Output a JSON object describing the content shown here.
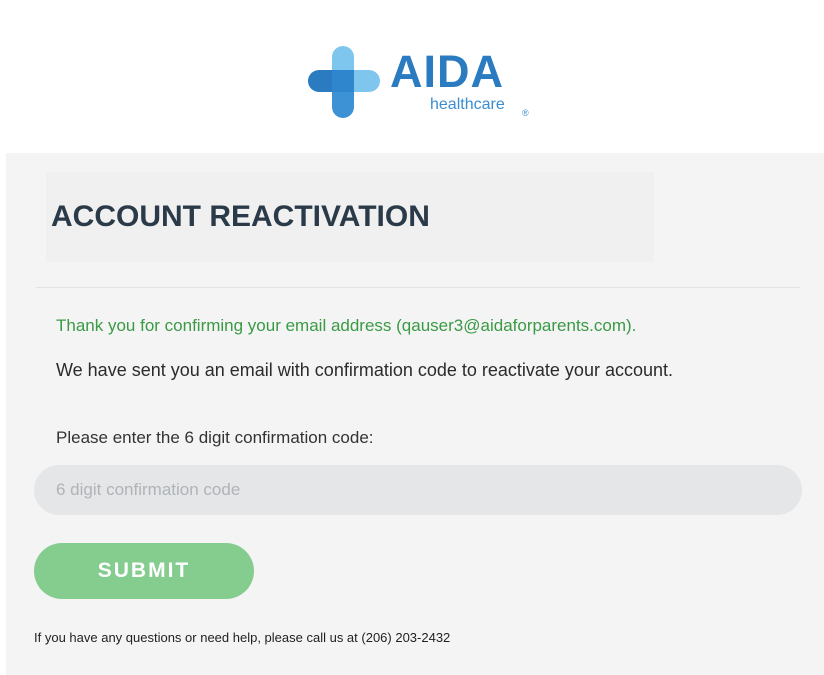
{
  "brand": {
    "name": "AIDA",
    "tagline": "healthcare",
    "registered": "®",
    "colors": {
      "primary": "#2a7bc0",
      "light": "#7ec6ee",
      "mid": "#3d92d6"
    }
  },
  "page": {
    "title": "ACCOUNT REACTIVATION",
    "confirmation_message": "Thank you for confirming your email address (qauser3@aidaforparents.com).",
    "sent_message": "We have sent you an email with confirmation code to reactivate your account.",
    "code_prompt": "Please enter the 6 digit confirmation code:"
  },
  "form": {
    "code_input": {
      "value": "",
      "placeholder": "6 digit confirmation code"
    },
    "submit_label": "SUBMIT"
  },
  "footer": {
    "help_text": "If you have any questions or need help, please call us at (206) 203-2432"
  },
  "colors": {
    "success_text": "#3a9a45",
    "submit_button": "#85cc8f",
    "panel_background": "#f4f4f4"
  }
}
